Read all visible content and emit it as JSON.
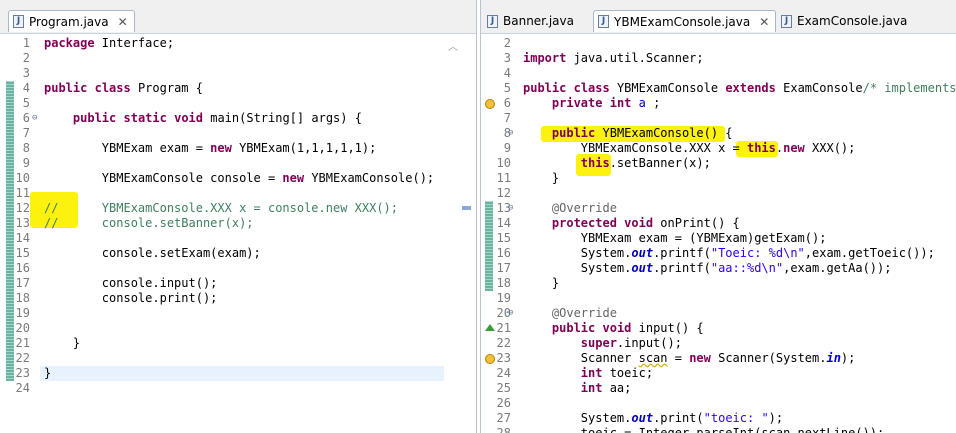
{
  "left_editor": {
    "tab": {
      "label": "Program.java",
      "close": "✕"
    },
    "lines": [
      {
        "n": "1",
        "t": "package Interface;"
      },
      {
        "n": "2",
        "t": ""
      },
      {
        "n": "3",
        "t": ""
      },
      {
        "n": "4",
        "t": "public class Program {"
      },
      {
        "n": "5",
        "t": ""
      },
      {
        "n": "6",
        "t": "    public static void main(String[] args) {"
      },
      {
        "n": "7",
        "t": ""
      },
      {
        "n": "8",
        "t": "        YBMExam exam = new YBMExam(1,1,1,1,1);"
      },
      {
        "n": "9",
        "t": ""
      },
      {
        "n": "10",
        "t": "        YBMExamConsole console = new YBMExamConsole();"
      },
      {
        "n": "11",
        "t": ""
      },
      {
        "n": "12",
        "t": "//      YBMExamConsole.XXX x = console.new XXX();"
      },
      {
        "n": "13",
        "t": "//      console.setBanner(x);"
      },
      {
        "n": "14",
        "t": ""
      },
      {
        "n": "15",
        "t": "        console.setExam(exam);"
      },
      {
        "n": "16",
        "t": ""
      },
      {
        "n": "17",
        "t": "        console.input();"
      },
      {
        "n": "18",
        "t": "        console.print();"
      },
      {
        "n": "19",
        "t": ""
      },
      {
        "n": "20",
        "t": ""
      },
      {
        "n": "21",
        "t": "    }"
      },
      {
        "n": "22",
        "t": ""
      },
      {
        "n": "23",
        "t": "}"
      },
      {
        "n": "24",
        "t": ""
      }
    ]
  },
  "right_editor": {
    "tabs": [
      {
        "label": "Banner.java",
        "close": ""
      },
      {
        "label": "YBMExamConsole.java",
        "close": "✕"
      },
      {
        "label": "ExamConsole.java",
        "close": ""
      }
    ],
    "lines": [
      {
        "n": "2",
        "t": ""
      },
      {
        "n": "3",
        "t": "import java.util.Scanner;"
      },
      {
        "n": "4",
        "t": ""
      },
      {
        "n": "5",
        "t": "public class YBMExamConsole extends ExamConsole/* implements B"
      },
      {
        "n": "6",
        "t": "    private int a ;"
      },
      {
        "n": "7",
        "t": ""
      },
      {
        "n": "8",
        "t": "    public YBMExamConsole() {"
      },
      {
        "n": "9",
        "t": "        YBMExamConsole.XXX x = this.new XXX();"
      },
      {
        "n": "10",
        "t": "        this.setBanner(x);"
      },
      {
        "n": "11",
        "t": "    }"
      },
      {
        "n": "12",
        "t": ""
      },
      {
        "n": "13",
        "t": "    @Override"
      },
      {
        "n": "14",
        "t": "    protected void onPrint() {"
      },
      {
        "n": "15",
        "t": "        YBMExam exam = (YBMExam)getExam();"
      },
      {
        "n": "16",
        "t": "        System.out.printf(\"Toeic: %d\\n\",exam.getToeic());"
      },
      {
        "n": "17",
        "t": "        System.out.printf(\"aa::%d\\n\",exam.getAa());"
      },
      {
        "n": "18",
        "t": "    }"
      },
      {
        "n": "19",
        "t": ""
      },
      {
        "n": "20",
        "t": "    @Override"
      },
      {
        "n": "21",
        "t": "    public void input() {"
      },
      {
        "n": "22",
        "t": "        super.input();"
      },
      {
        "n": "23",
        "t": "        Scanner scan = new Scanner(System.in);"
      },
      {
        "n": "24",
        "t": "        int toeic;"
      },
      {
        "n": "25",
        "t": "        int aa;"
      },
      {
        "n": "26",
        "t": ""
      },
      {
        "n": "27",
        "t": "        System.out.print(\"toeic: \");"
      },
      {
        "n": "28",
        "t": "        toeic = Integer.parseInt(scan.nextLine());"
      }
    ]
  },
  "colors": {
    "keyword": "#7f0055",
    "comment": "#3f7f5f",
    "string": "#2a00ff",
    "annotation": "#646464",
    "highlight": "#fcf100",
    "change_marker": "#69b3a0"
  },
  "icons": [
    "java-file-icon",
    "close-icon",
    "fold-icon",
    "warning-icon",
    "override-triangle-icon",
    "scroll-arrow-icon"
  ]
}
